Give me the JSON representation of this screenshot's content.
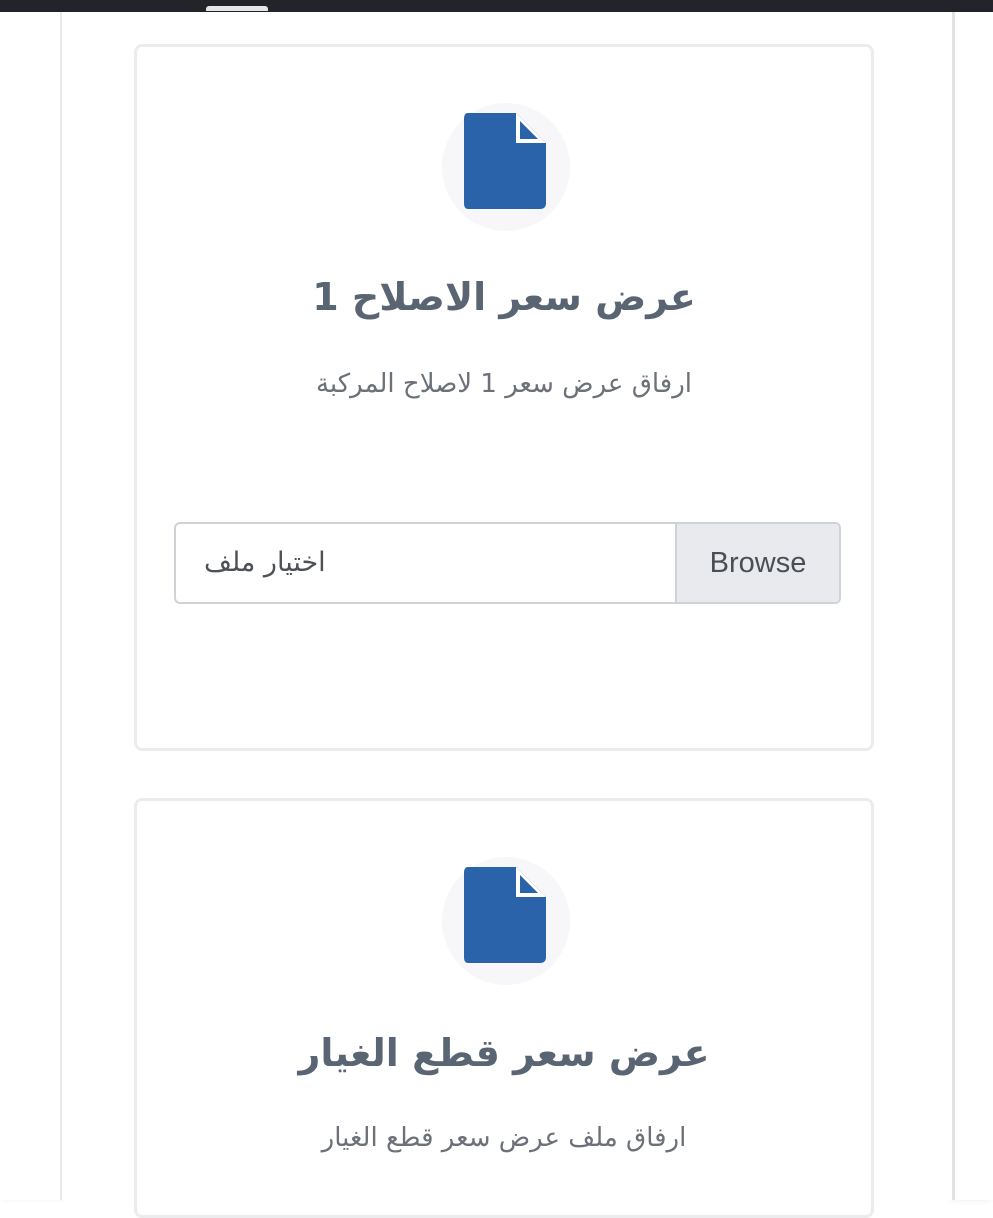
{
  "cards": [
    {
      "title": "عرض سعر الاصلاح 1",
      "subtitle": "ارفاق عرض سعر 1 لاصلاح المركبة",
      "file_input": {
        "placeholder": "اختيار ملف",
        "browse_label": "Browse"
      }
    },
    {
      "title": "عرض سعر قطع الغيار",
      "subtitle": "ارفاق ملف عرض سعر قطع الغيار"
    }
  ],
  "colors": {
    "icon": "#2a63aa",
    "title": "#5a6573",
    "subtitle": "#6c7078",
    "card_border": "#ececef",
    "browse_bg": "#e9eaee"
  },
  "icons": {
    "card_icon": "file-icon"
  }
}
